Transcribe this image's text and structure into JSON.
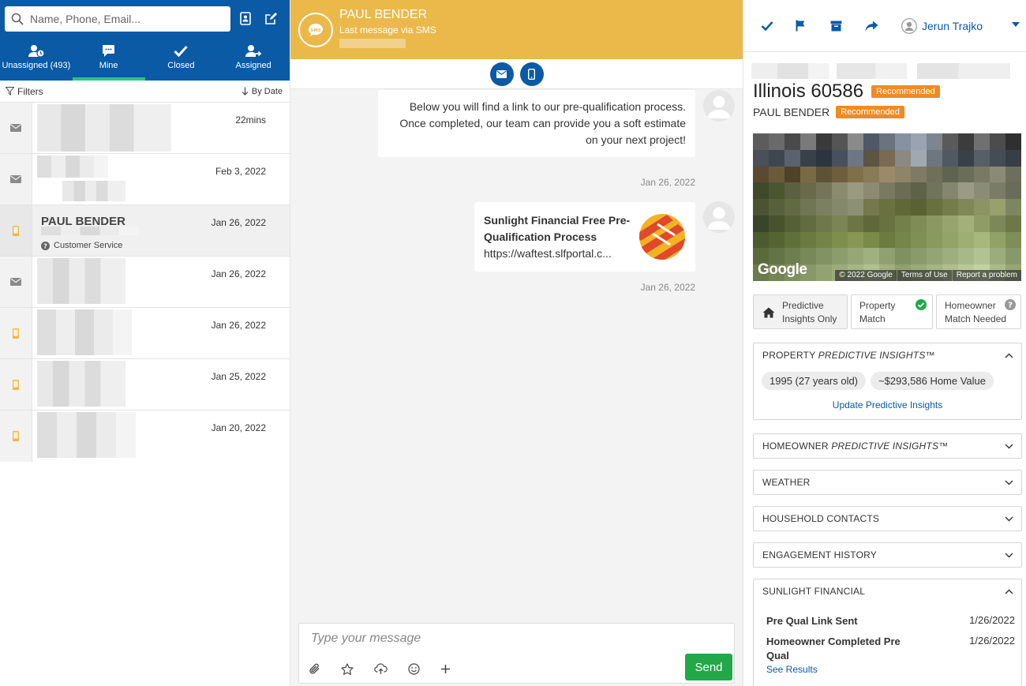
{
  "search": {
    "placeholder": "Name, Phone, Email..."
  },
  "tabs": [
    {
      "label": "Unassigned (493)"
    },
    {
      "label": "Mine"
    },
    {
      "label": "Closed"
    },
    {
      "label": "Assigned"
    }
  ],
  "filters": {
    "label": "Filters",
    "sort_label": "By Date"
  },
  "conversations": [
    {
      "channel": "email",
      "date": "22mins"
    },
    {
      "channel": "email",
      "date": "Feb 3, 2022"
    },
    {
      "channel": "sms",
      "name": "PAUL BENDER",
      "date": "Jan 26, 2022",
      "queue": "Customer Service"
    },
    {
      "channel": "email",
      "date": "Jan 26, 2022"
    },
    {
      "channel": "sms",
      "date": "Jan 26, 2022"
    },
    {
      "channel": "sms",
      "date": "Jan 25, 2022"
    },
    {
      "channel": "sms",
      "date": "Jan 20, 2022"
    }
  ],
  "chat": {
    "contact_name": "PAUL BENDER",
    "subtitle": "Last message via SMS",
    "messages": [
      {
        "text": "Below you will find a link to our pre-qualification process. Once completed, our team can provide you a soft estimate on your next project!",
        "timestamp": "Jan 26, 2022"
      },
      {
        "link_title": "Sunlight Financial Free Pre-Qualification Process",
        "link_url": "https://waftest.slfportal.c...",
        "timestamp": "Jan 26, 2022"
      }
    ],
    "composer_placeholder": "Type your message",
    "send_label": "Send"
  },
  "right": {
    "agent_name": "Jerun Trajko",
    "city_line": "Illinois 60586",
    "contact_name": "PAUL BENDER",
    "badge": "Recommended",
    "map": {
      "logo": "Google",
      "copyright": "© 2022 Google",
      "terms": "Terms of Use",
      "report": "Report a problem"
    },
    "match": {
      "predictive_l1": "Predictive",
      "predictive_l2": "Insights Only",
      "property_l1": "Property",
      "property_l2": "Match",
      "homeowner_l1": "Homeowner",
      "homeowner_l2": "Match Needed"
    },
    "property_insights": {
      "title_prefix": "PROPERTY ",
      "title_italic": "PREDICTIVE INSIGHTS",
      "tm": "™",
      "year": "1995 (27 years old)",
      "value": "~$293,586 Home Value",
      "update_link": "Update Predictive Insights"
    },
    "homeowner_insights": {
      "title_prefix": "HOMEOWNER ",
      "title_italic": "PREDICTIVE INSIGHTS",
      "tm": "™"
    },
    "sections": {
      "weather": "WEATHER",
      "household": "HOUSEHOLD CONTACTS",
      "engagement": "ENGAGEMENT HISTORY",
      "sunlight": "SUNLIGHT FINANCIAL"
    },
    "sunlight_rows": [
      {
        "label": "Pre Qual Link Sent",
        "date": "1/26/2022"
      },
      {
        "label": "Homeowner Completed Pre Qual",
        "date": "1/26/2022"
      }
    ],
    "see_results": "See Results"
  },
  "colors": {
    "brand_blue": "#0a5aa6",
    "chat_header": "#ebb94a",
    "badge_orange": "#f08a24",
    "send_green": "#22a848",
    "tab_indicator": "#2ec27e"
  }
}
